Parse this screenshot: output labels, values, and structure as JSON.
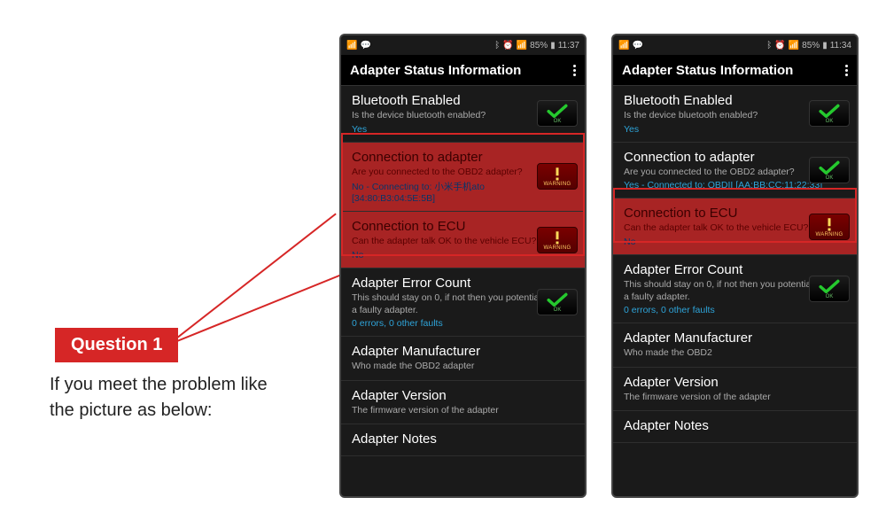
{
  "badge": {
    "label": "Question 1"
  },
  "text": "If you meet the prob­lem like the picture as below:",
  "statusbar_left": {
    "battery": "85%",
    "time": "11:37"
  },
  "statusbar_right": {
    "battery": "85%",
    "time": "11:34"
  },
  "titlebar": {
    "title": "Adapter Status Information"
  },
  "badges": {
    "ok": "OK",
    "warn": "WARNING"
  },
  "rows_left": [
    {
      "title": "Bluetooth Enabled",
      "sub": "Is the device bluetooth enabled?",
      "val": "Yes",
      "status": "ok"
    },
    {
      "title": "Connection to adapter",
      "sub": "Are you connected to the OBD2 adapter?",
      "val": "No - Connecting to: 小米手机ato\n[34:80:B3:04:5E:5B]",
      "status": "warn",
      "error": true
    },
    {
      "title": "Connection to ECU",
      "sub": "Can the adapter talk OK to the vehicle ECU?",
      "val": "No",
      "status": "warn",
      "error": true
    },
    {
      "title": "Adapter Error Count",
      "sub": "This should stay on 0, if not then you potentially have a faulty adapter.",
      "val": "0 errors, 0 other faults",
      "status": "ok"
    },
    {
      "title": "Adapter Manufacturer",
      "sub": "Who made the OBD2 adapter",
      "val": "",
      "status": ""
    },
    {
      "title": "Adapter Version",
      "sub": "The firmware version of the adapter",
      "val": "",
      "status": ""
    },
    {
      "title": "Adapter Notes",
      "sub": "",
      "val": "",
      "status": ""
    }
  ],
  "rows_right": [
    {
      "title": "Bluetooth Enabled",
      "sub": "Is the device bluetooth enabled?",
      "val": "Yes",
      "status": "ok"
    },
    {
      "title": "Connection to adapter",
      "sub": "Are you connected to the OBD2 adapter?",
      "val": "Yes - Connected to: OBDII [AA:BB:CC:11:22:33]",
      "status": "ok"
    },
    {
      "title": "Connection to ECU",
      "sub": "Can the adapter talk OK to the vehicle ECU?",
      "val": "No",
      "status": "warn",
      "error": true
    },
    {
      "title": "Adapter Error Count",
      "sub": "This should stay on 0, if not then you potentially have a faulty adapter.",
      "val": "0 errors, 0 other faults",
      "status": "ok"
    },
    {
      "title": "Adapter Manufacturer",
      "sub": "Who made the OBD2",
      "val": "",
      "status": ""
    },
    {
      "title": "Adapter Version",
      "sub": "The firmware version of the adapter",
      "val": "",
      "status": ""
    },
    {
      "title": "Adapter Notes",
      "sub": "",
      "val": "",
      "status": ""
    }
  ]
}
